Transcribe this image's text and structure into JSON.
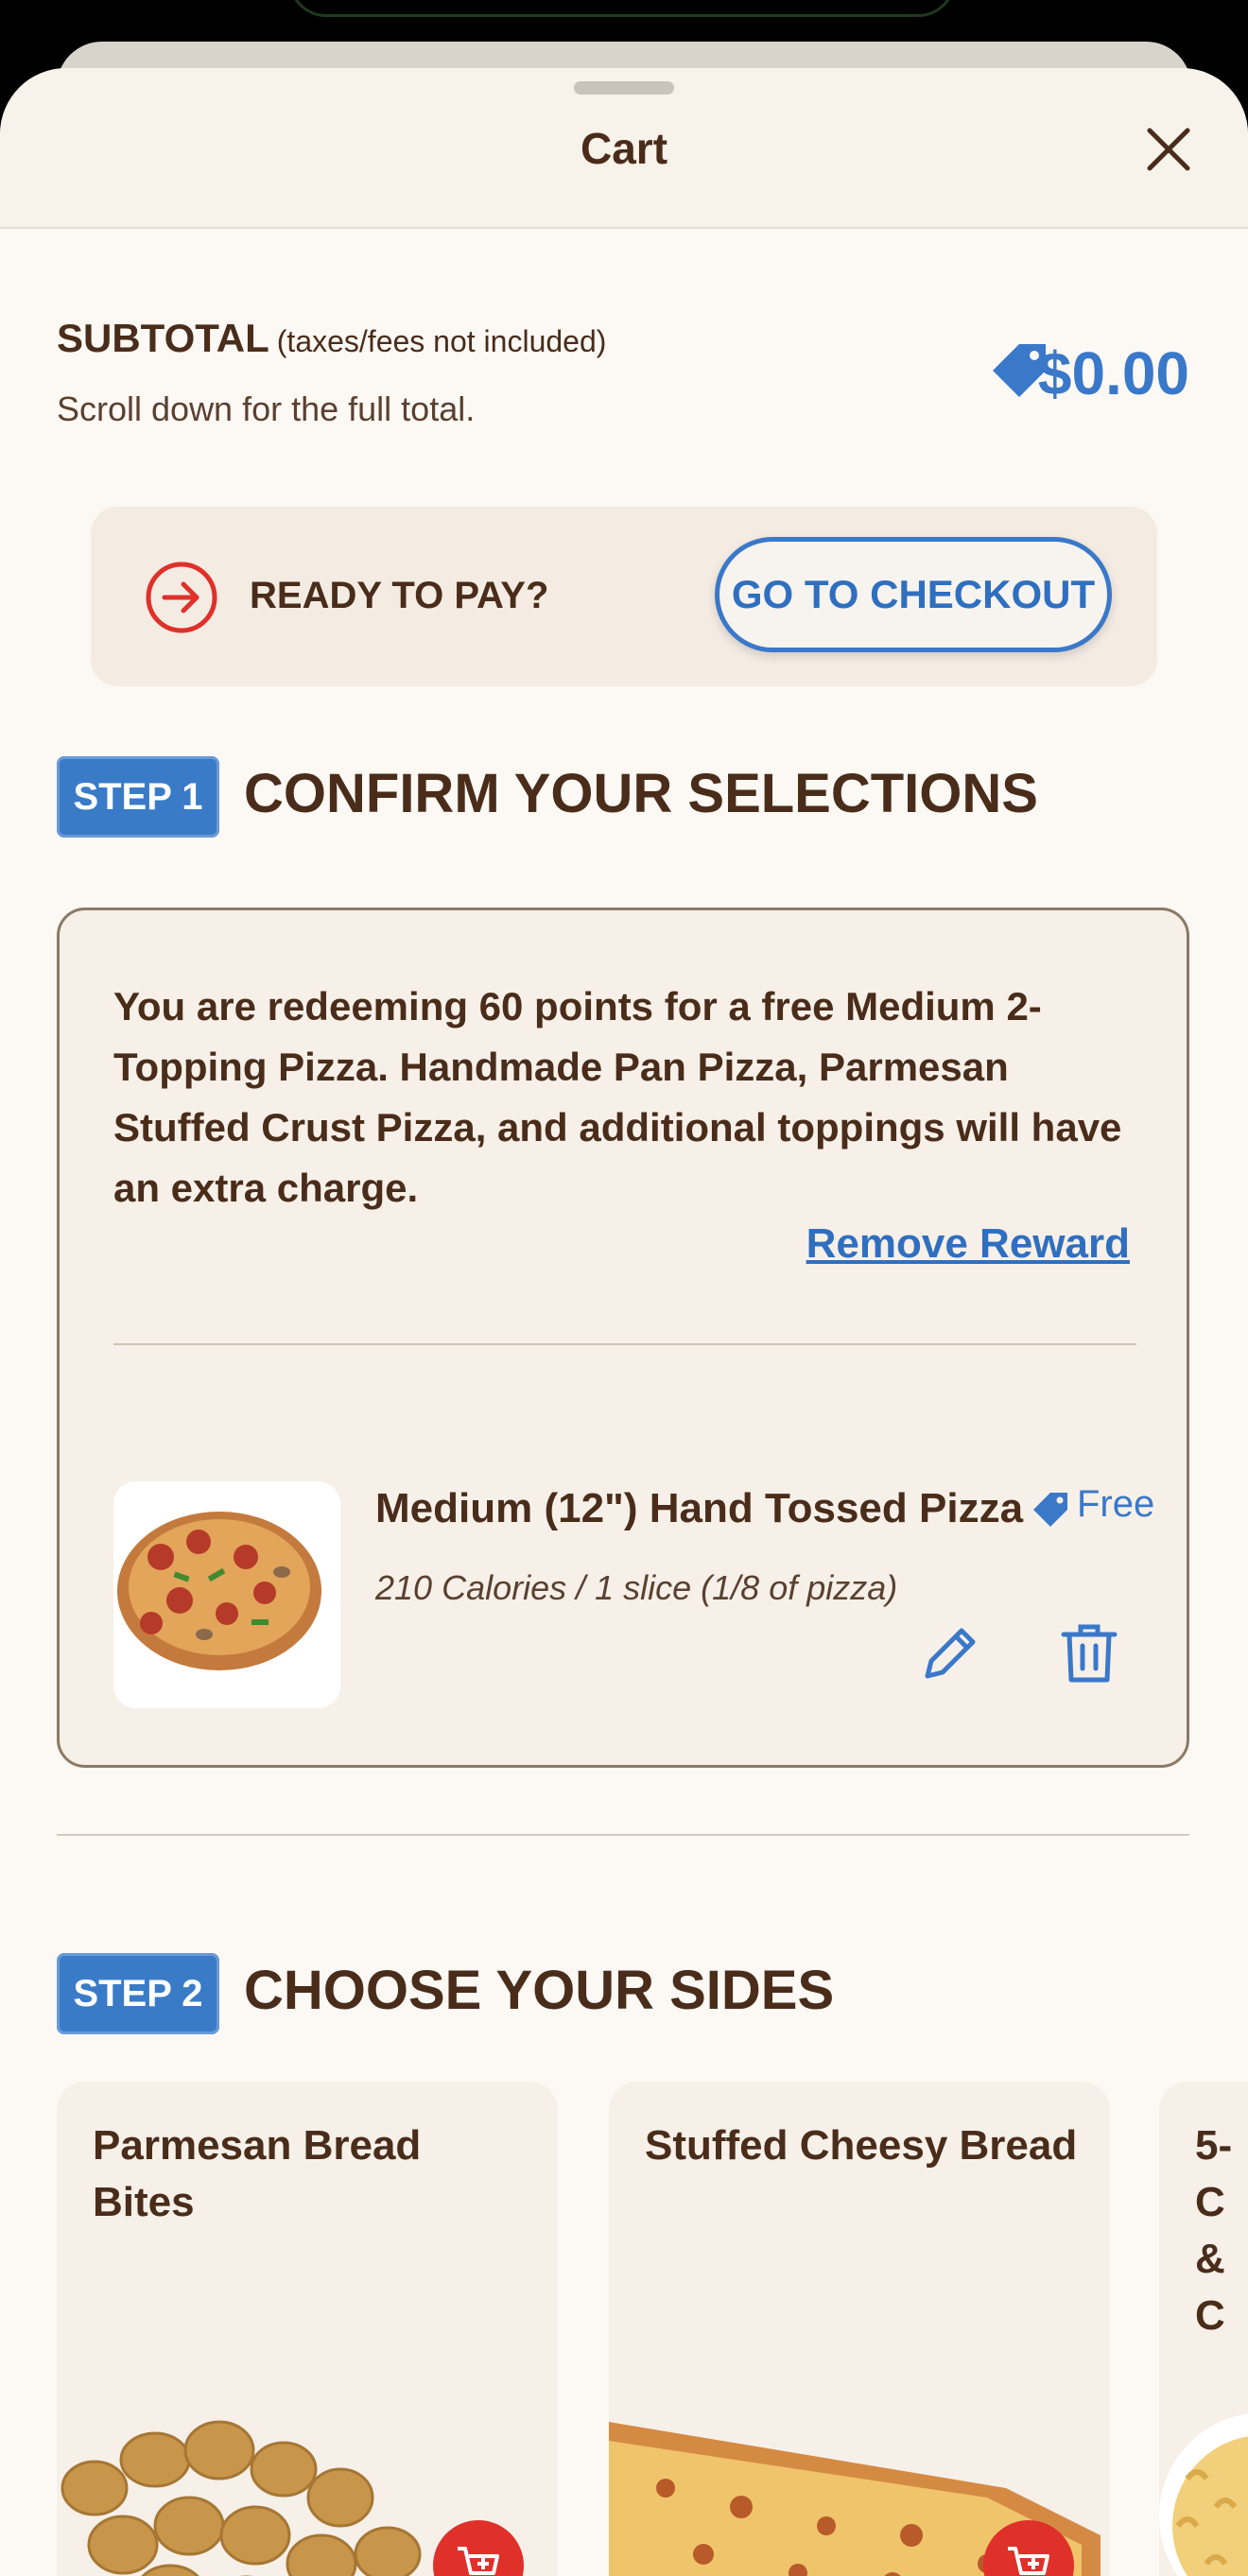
{
  "header": {
    "title": "Cart"
  },
  "subtotal": {
    "label": "SUBTOTAL",
    "note": "(taxes/fees not included)",
    "scroll_note": "Scroll down for the full total.",
    "value": "$0.00"
  },
  "ready": {
    "text": "READY TO PAY?",
    "checkout_label": "GO TO CHECKOUT"
  },
  "step1": {
    "badge": "STEP 1",
    "title": "CONFIRM YOUR SELECTIONS",
    "reward_text": "You are redeeming 60 points for a free Medium 2-Topping Pizza. Handmade Pan Pizza, Parmesan Stuffed Crust Pizza, and additional toppings will have an extra charge.",
    "remove_reward_label": "Remove Reward",
    "item": {
      "name": "Medium (12\") Hand Tossed Pizza",
      "calories": "210 Calories / 1 slice (1/8 of pizza)",
      "price": "Free"
    }
  },
  "step2": {
    "badge": "STEP 2",
    "title": "CHOOSE YOUR SIDES",
    "sides": [
      {
        "name": "Parmesan Bread Bites"
      },
      {
        "name": "Stuffed Cheesy Bread"
      },
      {
        "name": "5-C & C"
      }
    ]
  },
  "colors": {
    "accent_blue": "#3a78c9",
    "brown": "#4a2c1a",
    "red": "#e0302a"
  },
  "icons": [
    "close-icon",
    "price-tag-icon",
    "arrow-right-circle-icon",
    "edit-icon",
    "trash-icon",
    "add-to-cart-icon"
  ]
}
